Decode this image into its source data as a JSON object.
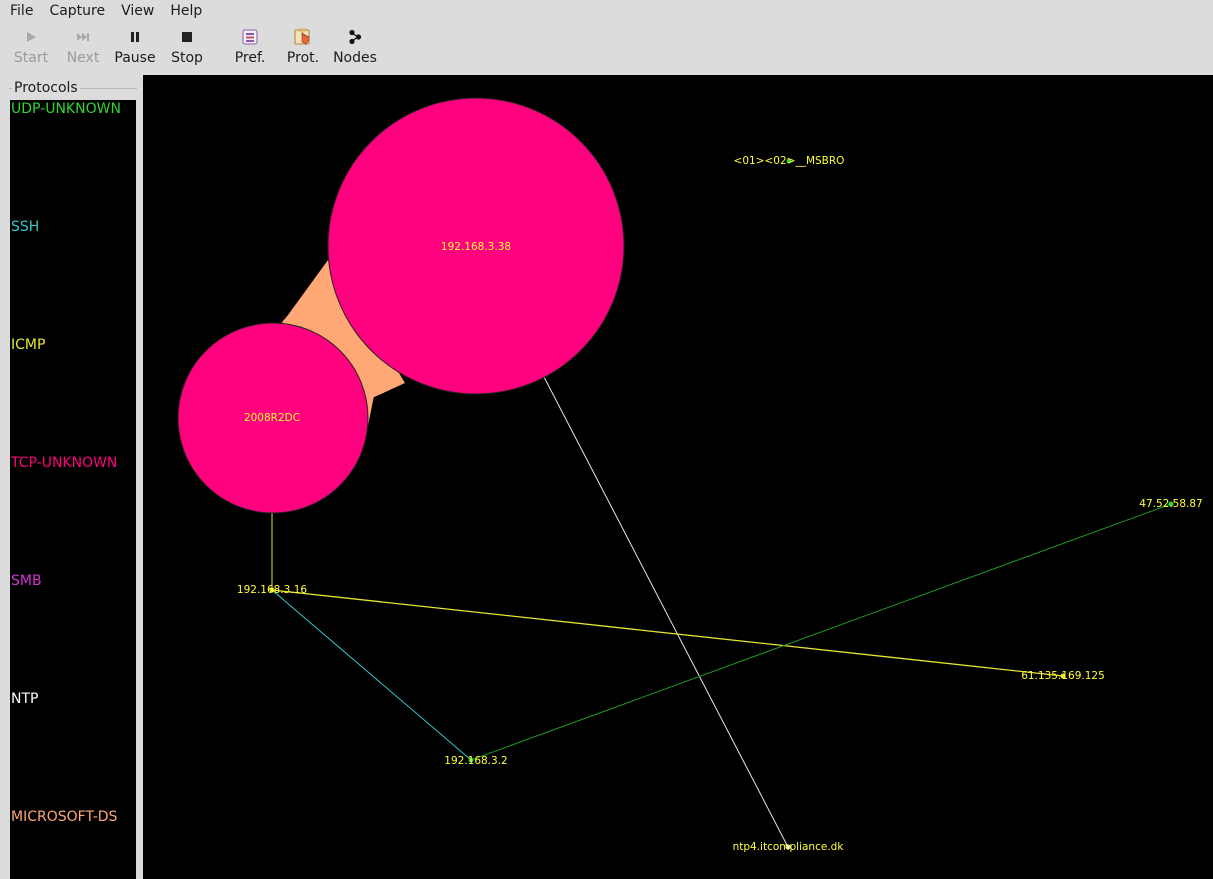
{
  "menu": [
    "File",
    "Capture",
    "View",
    "Help"
  ],
  "toolbar": {
    "start": "Start",
    "next": "Next",
    "pause": "Pause",
    "stop": "Stop",
    "pref": "Pref.",
    "prot": "Prot.",
    "nodes": "Nodes"
  },
  "protocols": {
    "title": "Protocols",
    "items": [
      {
        "label": "UDP-UNKNOWN",
        "color": "#33d633"
      },
      {
        "label": "SSH",
        "color": "#33c8c8"
      },
      {
        "label": "ICMP",
        "color": "#e6e633"
      },
      {
        "label": "TCP-UNKNOWN",
        "color": "#ff007f"
      },
      {
        "label": "SMB",
        "color": "#d633d6"
      },
      {
        "label": "NTP",
        "color": "#ffffff"
      },
      {
        "label": "MICROSOFT-DS",
        "color": "#ffa875"
      }
    ]
  },
  "graph": {
    "label_color": "#ffff33",
    "nodes": {
      "n192_168_3_38": "192.168.3.38",
      "n2008R2DC": "2008R2DC",
      "nMSBRO": "<01><02>__MSBRO",
      "n47_52_58_87": "47.52.58.87",
      "n192_168_3_16": "192.168.3.16",
      "n61_135_169_125": "61.135.169.125",
      "n192_168_3_2": "192.168.3.2",
      "nntp4": "ntp4.itcompliance.dk"
    }
  }
}
